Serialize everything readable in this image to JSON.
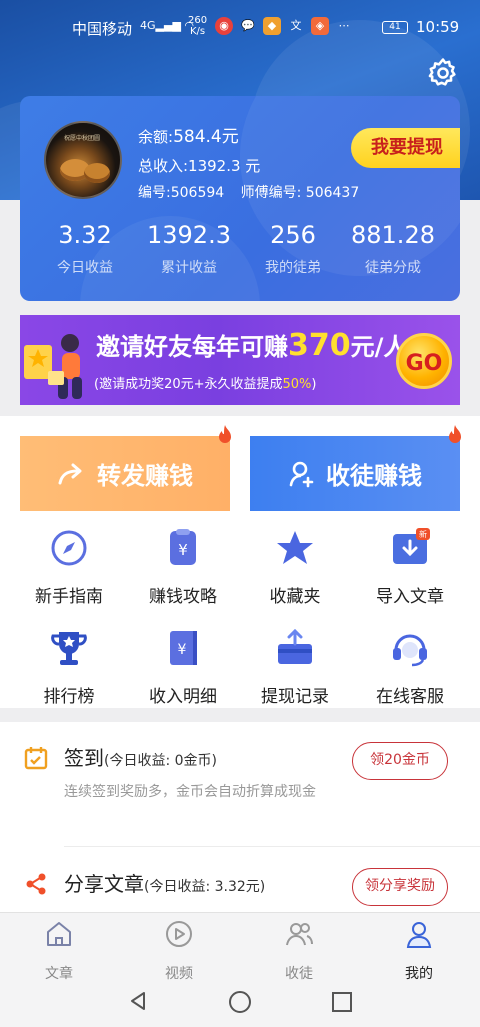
{
  "status_bar": {
    "carrier": "中国移动",
    "signal": "4G",
    "speed_value": "260",
    "speed_unit": "K/s",
    "battery": "41",
    "time": "10:59"
  },
  "profile": {
    "avatar_caption": "祝愿中秋团圆",
    "balance_label": "余额:",
    "balance_value": "584.4元",
    "total_income": "总收入:1392.3 元",
    "user_id": "编号:506594",
    "master_id": "师傅编号: 506437",
    "withdraw_label": "我要提现",
    "stats": [
      {
        "value": "3.32",
        "label": "今日收益"
      },
      {
        "value": "1392.3",
        "label": "累计收益"
      },
      {
        "value": "256",
        "label": "我的徒弟"
      },
      {
        "value": "881.28",
        "label": "徒弟分成"
      }
    ]
  },
  "invite_banner": {
    "title_prefix": "邀请好友每年可赚",
    "amount": "370",
    "title_suffix": "元/人",
    "sub_prefix": "(邀请成功奖20元+永久收益提成",
    "sub_percent": "50%",
    "sub_suffix": ")",
    "go_label": "GO"
  },
  "actions": {
    "share_earn": "转发赚钱",
    "recruit_earn": "收徒赚钱"
  },
  "grid": [
    {
      "label": "新手指南",
      "icon": "compass-icon"
    },
    {
      "label": "赚钱攻略",
      "icon": "money-guide-icon"
    },
    {
      "label": "收藏夹",
      "icon": "star-icon"
    },
    {
      "label": "导入文章",
      "icon": "import-article-icon"
    },
    {
      "label": "排行榜",
      "icon": "trophy-icon"
    },
    {
      "label": "收入明细",
      "icon": "income-book-icon"
    },
    {
      "label": "提现记录",
      "icon": "withdraw-record-icon"
    },
    {
      "label": "在线客服",
      "icon": "headset-icon"
    }
  ],
  "tasks": [
    {
      "title": "签到",
      "today": "(今日收益: 0金币)",
      "desc": "连续签到奖励多，金币会自动折算成现金",
      "button": "领20金币"
    },
    {
      "title": "分享文章",
      "today": "(今日收益: 3.32元)",
      "desc": "",
      "button": "领分享奖励"
    }
  ],
  "tabs": [
    {
      "label": "文章",
      "icon": "home-icon"
    },
    {
      "label": "视频",
      "icon": "play-icon"
    },
    {
      "label": "收徒",
      "icon": "users-icon"
    },
    {
      "label": "我的",
      "icon": "profile-icon"
    }
  ],
  "colors": {
    "header": "#1e56b0",
    "card": "#3a6ee0",
    "accent_red": "#c8343a",
    "accent_yellow": "#ffd21e",
    "orange_btn": "#ffb067",
    "blue_btn": "#3d7ff0",
    "purple_banner": "#8a47e6"
  }
}
